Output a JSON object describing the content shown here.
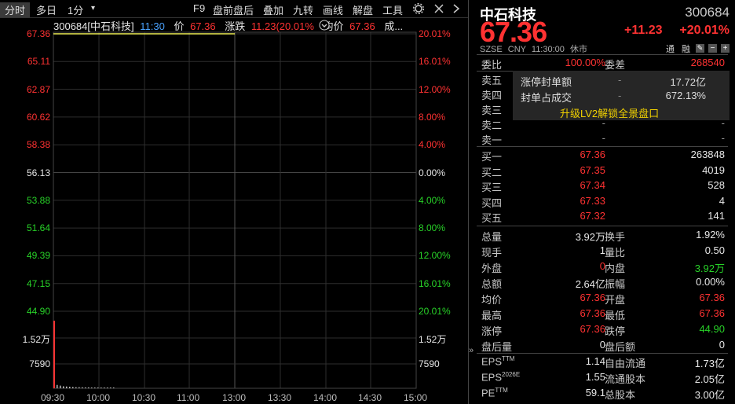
{
  "toolbar": {
    "items": [
      "分时",
      "多日",
      "1分",
      "F9",
      "盘前盘后",
      "叠加",
      "九转",
      "画线",
      "解盘",
      "工具"
    ],
    "dropdown": "▾"
  },
  "legend": {
    "code_name": "300684[中石科技]",
    "time": "11:30",
    "price_label": "价",
    "price": "67.36",
    "change_label": "涨跌",
    "change": "11.23(20.01%",
    "avg_label": "均价",
    "avg": "67.36",
    "more": "成..."
  },
  "chart_data": {
    "type": "line",
    "x_ticks": [
      "09:30",
      "10:00",
      "10:30",
      "11:00",
      "13:00",
      "13:30",
      "14:00",
      "14:30",
      "15:00"
    ],
    "price_ticks_left": [
      "67.36",
      "65.11",
      "62.87",
      "60.62",
      "58.38",
      "56.13",
      "53.88",
      "51.64",
      "49.39",
      "47.15",
      "44.90"
    ],
    "pct_ticks_right": [
      "20.01%",
      "16.01%",
      "12.00%",
      "8.00%",
      "4.00%",
      "0.00%",
      "4.00%",
      "8.00%",
      "12.00%",
      "16.01%",
      "20.01%"
    ],
    "volume_ticks_left": [
      "1.52万",
      "7590"
    ],
    "volume_ticks_right": [
      "1.52万",
      "7590"
    ],
    "prev_close": 56.13,
    "ylim": [
      44.9,
      67.36
    ],
    "series": [
      {
        "name": "价",
        "x": [
          "09:30",
          "11:30"
        ],
        "values": [
          67.36,
          67.36
        ]
      },
      {
        "name": "均价",
        "x": [
          "09:30",
          "11:30"
        ],
        "values": [
          67.36,
          67.36
        ]
      }
    ],
    "volume": [
      30360,
      1500,
      1200,
      900,
      800,
      700,
      600,
      500,
      500,
      450,
      400,
      400,
      350,
      300,
      300,
      250,
      200,
      200,
      150,
      150
    ]
  },
  "quote": {
    "name": "中石科技",
    "code": "300684",
    "price": "67.36",
    "change": "+11.23",
    "change_pct": "+20.01%",
    "market": "SZSE",
    "currency": "CNY",
    "time": "11:30:00",
    "status": "休市",
    "tag1": "通",
    "tag2": "融"
  },
  "ratio": {
    "label1": "委比",
    "value1": "100.00%",
    "label2": "委差",
    "value2": "268540"
  },
  "sells": [
    {
      "label": "卖五",
      "price": "-",
      "vol": "-"
    },
    {
      "label": "卖四",
      "price": "-",
      "vol": "-"
    },
    {
      "label": "卖三",
      "price": "-",
      "vol": "-"
    },
    {
      "label": "卖二",
      "price": "-",
      "vol": "-"
    },
    {
      "label": "卖一",
      "price": "-",
      "vol": "-"
    }
  ],
  "limit_popup": {
    "line1_label": "涨停封单额",
    "line1_dash": "-",
    "line1_value": "17.72亿",
    "line2_label": "封单占成交",
    "line2_dash": "-",
    "line2_value": "672.13%",
    "upgrade": "升级LV2解锁全景盘口"
  },
  "buys": [
    {
      "label": "买一",
      "price": "67.36",
      "vol": "263848"
    },
    {
      "label": "买二",
      "price": "67.35",
      "vol": "4019"
    },
    {
      "label": "买三",
      "price": "67.34",
      "vol": "528"
    },
    {
      "label": "买四",
      "price": "67.33",
      "vol": "4"
    },
    {
      "label": "买五",
      "price": "67.32",
      "vol": "141"
    }
  ],
  "stats": [
    {
      "l1": "总量",
      "v1": "3.92万",
      "l2": "换手",
      "v2": "1.92%",
      "c1": "white",
      "c2": "white"
    },
    {
      "l1": "现手",
      "v1": "1",
      "l2": "量比",
      "v2": "0.50",
      "c1": "white",
      "c2": "white"
    },
    {
      "l1": "外盘",
      "v1": "0",
      "l2": "内盘",
      "v2": "3.92万",
      "c1": "red",
      "c2": "green"
    },
    {
      "l1": "总额",
      "v1": "2.64亿",
      "l2": "振幅",
      "v2": "0.00%",
      "c1": "white",
      "c2": "white"
    },
    {
      "l1": "均价",
      "v1": "67.36",
      "l2": "开盘",
      "v2": "67.36",
      "c1": "red",
      "c2": "red"
    },
    {
      "l1": "最高",
      "v1": "67.36",
      "l2": "最低",
      "v2": "67.36",
      "c1": "red",
      "c2": "red"
    },
    {
      "l1": "涨停",
      "v1": "67.36",
      "l2": "跌停",
      "v2": "44.90",
      "c1": "red",
      "c2": "green"
    },
    {
      "l1": "盘后量",
      "v1": "0",
      "l2": "盘后额",
      "v2": "0",
      "c1": "white",
      "c2": "white"
    }
  ],
  "fin": [
    {
      "l1": "EPS",
      "s1": "TTM",
      "v1": "1.14",
      "l2": "自由流通",
      "v2": "1.73亿"
    },
    {
      "l1": "EPS",
      "s1": "2026E",
      "v1": "1.55",
      "l2": "流通股本",
      "v2": "2.05亿"
    },
    {
      "l1": "PE",
      "s1": "TTM",
      "v1": "59.1",
      "l2": "总股本",
      "v2": "3.00亿"
    }
  ],
  "colors": {
    "up": "#ff3232",
    "down": "#28d228",
    "bg": "#000000",
    "grid": "#2e2e2e",
    "avg_line": "#e6e600"
  }
}
